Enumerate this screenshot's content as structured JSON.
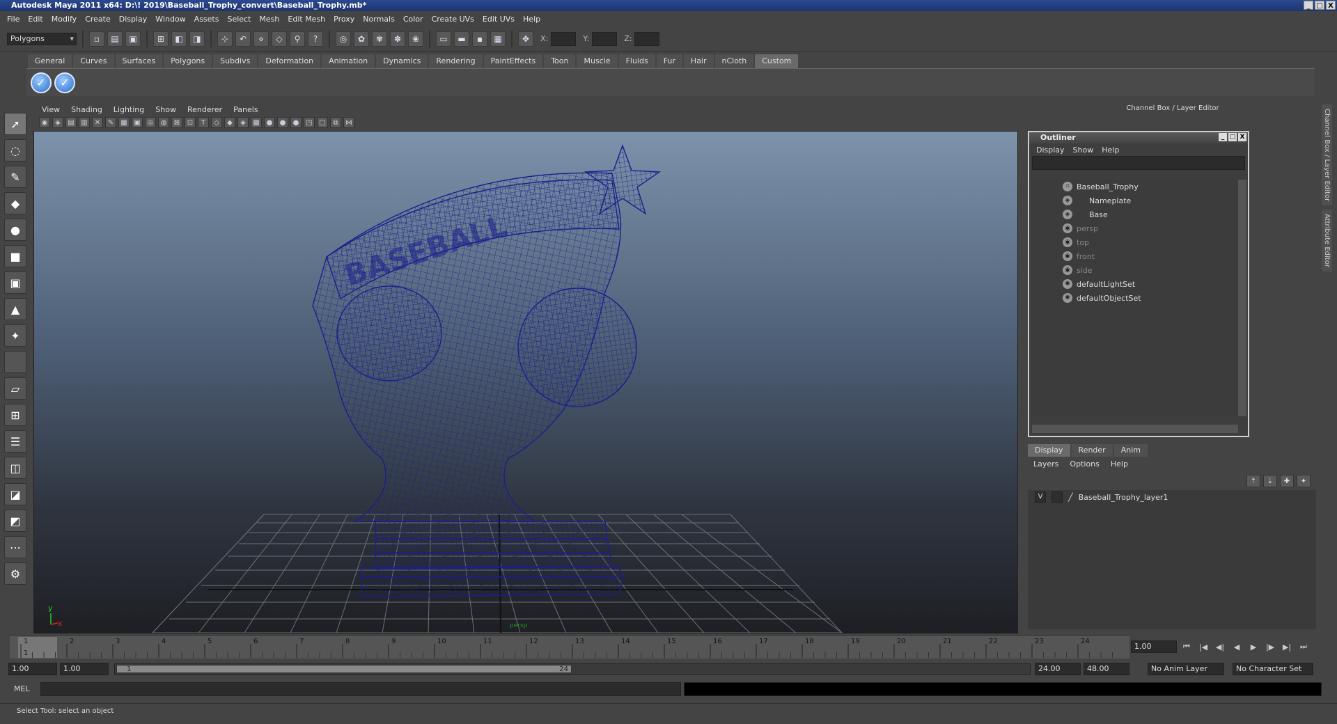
{
  "window": {
    "title": "Autodesk Maya 2011 x64: D:\\! 2019\\Baseball_Trophy_convert\\Baseball_Trophy.mb*",
    "buttons": [
      "_",
      "□",
      "X"
    ]
  },
  "menubar": [
    "File",
    "Edit",
    "Modify",
    "Create",
    "Display",
    "Window",
    "Assets",
    "Select",
    "Mesh",
    "Edit Mesh",
    "Proxy",
    "Normals",
    "Color",
    "Create UVs",
    "Edit UVs",
    "Help"
  ],
  "statusline": {
    "mode": "Polygons",
    "x_label": "X:",
    "y_label": "Y:",
    "z_label": "Z:"
  },
  "shelf": {
    "tabs": [
      "General",
      "Curves",
      "Surfaces",
      "Polygons",
      "Subdivs",
      "Deformation",
      "Animation",
      "Dynamics",
      "Rendering",
      "PaintEffects",
      "Toon",
      "Muscle",
      "Fluids",
      "Fur",
      "Hair",
      "nCloth",
      "Custom"
    ],
    "active_tab": "Custom"
  },
  "panel": {
    "menus": [
      "View",
      "Shading",
      "Lighting",
      "Show",
      "Renderer",
      "Panels"
    ],
    "viewport_label": "persp",
    "axis_y": "y",
    "axis_x": "x"
  },
  "channel_box": {
    "title": "Channel Box / Layer Editor"
  },
  "side_tabs": [
    "Channel Box / Layer Editor",
    "Attribute Editor"
  ],
  "outliner": {
    "title": "Outliner",
    "menus": [
      "Display",
      "Show",
      "Help"
    ],
    "items": [
      {
        "label": "Baseball_Trophy",
        "dim": false
      },
      {
        "label": "Nameplate",
        "dim": false
      },
      {
        "label": "Base",
        "dim": false
      },
      {
        "label": "persp",
        "dim": true
      },
      {
        "label": "top",
        "dim": true
      },
      {
        "label": "front",
        "dim": true
      },
      {
        "label": "side",
        "dim": true
      },
      {
        "label": "defaultLightSet",
        "dim": false
      },
      {
        "label": "defaultObjectSet",
        "dim": false
      }
    ]
  },
  "layer_editor": {
    "tabs": [
      "Display",
      "Render",
      "Anim"
    ],
    "active_tab": "Display",
    "menus": [
      "Layers",
      "Options",
      "Help"
    ],
    "layers": [
      {
        "visible": "V",
        "name": "Baseball_Trophy_layer1"
      }
    ]
  },
  "timeline": {
    "ticks": [
      "1",
      "2",
      "3",
      "4",
      "5",
      "6",
      "7",
      "8",
      "9",
      "10",
      "11",
      "12",
      "13",
      "14",
      "15",
      "16",
      "17",
      "18",
      "19",
      "20",
      "21",
      "22",
      "23",
      "24"
    ],
    "current_frame_marker": "1",
    "current_time": "1.00"
  },
  "range": {
    "start": "1.00",
    "playback_start": "1.00",
    "slider_start": "1",
    "slider_end": "24",
    "playback_end": "24.00",
    "end": "48.00",
    "anim_layer": "No Anim Layer",
    "character_set": "No Character Set"
  },
  "command": {
    "label": "MEL"
  },
  "help_line": "Select Tool: select an object",
  "colors": {
    "wireframe": "#1a1f8c",
    "background": "#444444"
  }
}
